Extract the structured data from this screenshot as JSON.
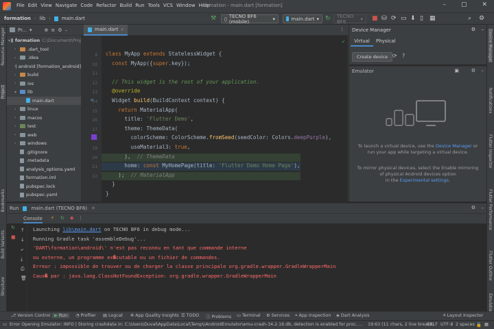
{
  "window": {
    "menu": [
      "File",
      "Edit",
      "View",
      "Navigate",
      "Code",
      "Refactor",
      "Build",
      "Run",
      "Tools",
      "VCS",
      "Window",
      "Help"
    ],
    "title": "formation - main.dart [formation]"
  },
  "navbar": {
    "crumbs": [
      "formation",
      "lib",
      "main.dart"
    ],
    "device_combo": "TECNO BF6 (mobile)",
    "run_config": "main.dart",
    "device2": "TECNO BF6"
  },
  "project": {
    "header": "Pr...",
    "items": [
      {
        "label": "formation",
        "detail": "C:\\Document\\Proj",
        "type": "folder",
        "indent": 0,
        "caret": "▾"
      },
      {
        "label": ".dart_tool",
        "type": "orange",
        "indent": 1,
        "caret": "›"
      },
      {
        "label": ".idea",
        "type": "folder",
        "indent": 1,
        "caret": "›"
      },
      {
        "label": "android [formation_android]",
        "type": "folder",
        "indent": 1,
        "caret": "›"
      },
      {
        "label": "build",
        "type": "orange",
        "indent": 1,
        "caret": "›"
      },
      {
        "label": "ios",
        "type": "folder",
        "indent": 1,
        "caret": "›"
      },
      {
        "label": "lib",
        "type": "blue",
        "indent": 1,
        "caret": "▾"
      },
      {
        "label": "main.dart",
        "type": "dart",
        "indent": 2,
        "caret": ""
      },
      {
        "label": "linux",
        "type": "folder",
        "indent": 1,
        "caret": "›"
      },
      {
        "label": "macos",
        "type": "folder",
        "indent": 1,
        "caret": "›"
      },
      {
        "label": "test",
        "type": "green",
        "indent": 1,
        "caret": "›"
      },
      {
        "label": "web",
        "type": "folder",
        "indent": 1,
        "caret": "›"
      },
      {
        "label": "windows",
        "type": "folder",
        "indent": 1,
        "caret": "›"
      },
      {
        "label": ".gitignore",
        "type": "file",
        "indent": 1,
        "caret": ""
      },
      {
        "label": ".metadata",
        "type": "file",
        "indent": 1,
        "caret": ""
      },
      {
        "label": "analysis_options.yaml",
        "type": "file",
        "indent": 1,
        "caret": ""
      },
      {
        "label": "formation.iml",
        "type": "file",
        "indent": 1,
        "caret": ""
      },
      {
        "label": "pubspec.lock",
        "type": "file",
        "indent": 1,
        "caret": ""
      },
      {
        "label": "pubspec.yaml",
        "type": "file",
        "indent": 1,
        "caret": ""
      }
    ]
  },
  "editor": {
    "tab": "main.dart",
    "line_numbers": [
      "9",
      "10",
      "11",
      "12",
      "13",
      "14",
      "15",
      "16",
      "17",
      "18",
      "19",
      "20",
      "21",
      "22"
    ],
    "lines": [
      [
        {
          "t": "class ",
          "c": "kw"
        },
        {
          "t": "MyApp ",
          "c": "ident"
        },
        {
          "t": "extends ",
          "c": "kw"
        },
        {
          "t": "StatelessWidget {",
          "c": "ident"
        }
      ],
      [
        {
          "t": "  const ",
          "c": "kw"
        },
        {
          "t": "MyApp({",
          "c": "ident"
        },
        {
          "t": "super",
          "c": "kw"
        },
        {
          "t": ".key});",
          "c": "ident"
        }
      ],
      [],
      [
        {
          "t": "  // This widget is the root of your application.",
          "c": "cm"
        }
      ],
      [
        {
          "t": "  @override",
          "c": "ann"
        }
      ],
      [
        {
          "t": "  Widget ",
          "c": "ident"
        },
        {
          "t": "build",
          "c": "cls"
        },
        {
          "t": "(BuildContext context) {",
          "c": "ident"
        }
      ],
      [
        {
          "t": "    return ",
          "c": "kw"
        },
        {
          "t": "MaterialApp(",
          "c": "ident"
        }
      ],
      [
        {
          "t": "      title: ",
          "c": "ident"
        },
        {
          "t": "'Flutter Demo'",
          "c": "str"
        },
        {
          "t": ",",
          "c": "ident"
        }
      ],
      [
        {
          "t": "      theme: ",
          "c": "ident"
        },
        {
          "t": "ThemeData(",
          "c": "ident"
        }
      ],
      [
        {
          "t": "        colorScheme: ColorScheme.",
          "c": "ident"
        },
        {
          "t": "fromSeed",
          "c": "cls"
        },
        {
          "t": "(seedColor: Colors.",
          "c": "ident"
        },
        {
          "t": "deepPurple",
          "c": "fld"
        },
        {
          "t": "),",
          "c": "ident"
        }
      ],
      [
        {
          "t": "        useMaterial3: ",
          "c": "ident"
        },
        {
          "t": "true",
          "c": "kw"
        },
        {
          "t": ",",
          "c": "ident"
        }
      ],
      [
        {
          "t": "      ),  ",
          "c": "ident"
        },
        {
          "t": "// ThemeData",
          "c": "cmd"
        }
      ],
      [
        {
          "t": "      home: ",
          "c": "ident"
        },
        {
          "t": "const ",
          "c": "kw"
        },
        {
          "t": "MyHomePage(title: ",
          "c": "ident"
        },
        {
          "t": "'Flutter Demo Home Page'",
          "c": "str"
        },
        {
          "t": "),",
          "c": "ident"
        }
      ],
      [
        {
          "t": "    );  ",
          "c": "ident"
        },
        {
          "t": "// MaterialApp",
          "c": "cmd"
        }
      ],
      [
        {
          "t": "  }",
          "c": "ident"
        }
      ],
      [
        {
          "t": "}",
          "c": "ident"
        }
      ]
    ]
  },
  "device_manager": {
    "title": "Device Manager",
    "tabs": [
      "Virtual",
      "Physical"
    ],
    "create_button": "Create device"
  },
  "emulator": {
    "title": "Emulator",
    "launch_pre": "To launch a virtual device, use the ",
    "launch_link": "Device Manager",
    "launch_post": " or",
    "launch_line2": "run your app while targeting a virtual device.",
    "mirror_line1": "To mirror physical devices, select the Enable mirroring",
    "mirror_line2": "of physical Android devices option",
    "mirror_pre": "in the ",
    "mirror_link": "Experimental settings",
    "mirror_post": "."
  },
  "run": {
    "label": "Run",
    "tab": "main.dart (TECNO BF6)",
    "console_tab": "Console",
    "lines": [
      {
        "parts": [
          {
            "t": "Launching ",
            "c": "norm"
          },
          {
            "t": "lib\\main.dart",
            "c": "link"
          },
          {
            "t": " on TECNO BF6 in debug mode...",
            "c": "norm"
          }
        ]
      },
      {
        "parts": [
          {
            "t": "Running Gradle task 'assembleDebug'...",
            "c": "norm"
          }
        ]
      },
      {
        "parts": [
          {
            "t": "'DART\\formation\\android\\' n'est pas reconnu en tant que commande interne",
            "c": "err"
          }
        ]
      },
      {
        "parts": [
          {
            "t": "ou externe, un programme ex�cutable ou un fichier de commandes.",
            "c": "err"
          }
        ]
      },
      {
        "parts": [
          {
            "t": "Erreur : impossible de trouver ou de charger la classe principale org.gradle.wrapper.GradleWrapperMain",
            "c": "err"
          }
        ]
      },
      {
        "parts": [
          {
            "t": "Caus� par : java.lang.ClassNotFoundException: org.gradle.wrapper.GradleWrapperMain",
            "c": "err"
          }
        ]
      }
    ]
  },
  "bottom_tabs": [
    "Version Control",
    "Run",
    "Profiler",
    "Logcat",
    "App Quality Insights",
    "TODO",
    "Problems",
    "Terminal",
    "Services",
    "App Inspection",
    "Dart Analysis",
    "Layout Inspector"
  ],
  "status": {
    "message": "Error Opening Emulator: INFO  | Storing crashdata in: C:\\Users\\Duval\\AppData\\Local\\Temp\\\\AndroidEmulator\\emu-crash-34.2.16.db, detection is enabled for proc... (a minute ago)",
    "position": "19:63 (11 chars, 2 line breaks)",
    "line_sep": "CRLF",
    "encoding": "UTF-8",
    "indent": "2 spaces"
  },
  "side_labels": {
    "left": [
      "Resource Manager",
      "Project",
      "Bookmarks",
      "Build Variants",
      "Structure"
    ],
    "right": [
      "Device Manager",
      "Notifications",
      "Flutter Inspector",
      "Flutter Performance",
      "Flutter Outline",
      "Emulator"
    ]
  },
  "colors": {
    "accent": "#4a88c7",
    "error": "#ff6b68",
    "link": "#589df6"
  }
}
